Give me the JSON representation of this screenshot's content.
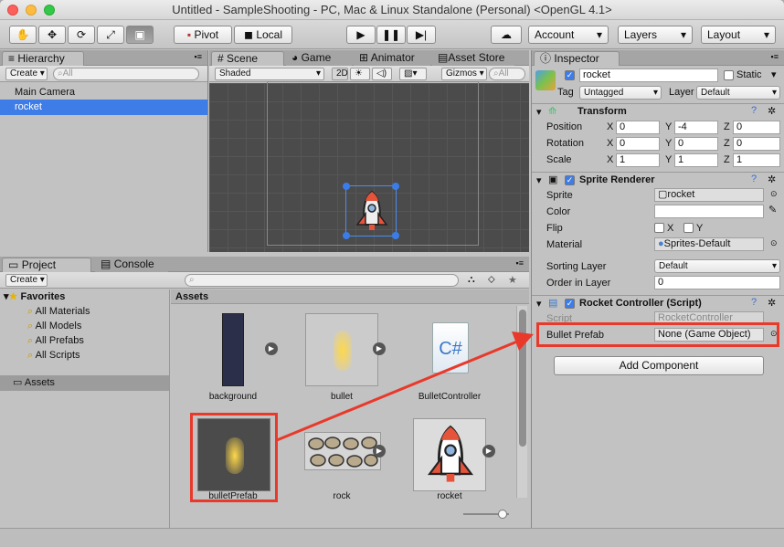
{
  "window": {
    "title": "Untitled - SampleShooting - PC, Mac & Linux Standalone (Personal) <OpenGL 4.1>"
  },
  "toolbar": {
    "pivot": "Pivot",
    "local": "Local",
    "account": "Account",
    "layers": "Layers",
    "layout": "Layout"
  },
  "hierarchy": {
    "tab": "Hierarchy",
    "create": "Create",
    "search_placeholder": "All",
    "items": [
      "Main Camera",
      "rocket"
    ],
    "selected": "rocket"
  },
  "scene": {
    "tabs": [
      "Scene",
      "Game",
      "Animator",
      "Asset Store"
    ],
    "shading": "Shaded",
    "mode2d": "2D",
    "gizmos": "Gizmos",
    "search_placeholder": "All"
  },
  "project": {
    "tabs": [
      "Project",
      "Console"
    ],
    "create": "Create",
    "favorites": "Favorites",
    "fav_items": [
      "All Materials",
      "All Models",
      "All Prefabs",
      "All Scripts"
    ],
    "assets_root": "Assets",
    "breadcrumb": "Assets",
    "assets": [
      "background",
      "bullet",
      "BulletController",
      "bulletPrefab",
      "rock",
      "rocket"
    ]
  },
  "inspector": {
    "tab": "Inspector",
    "name": "rocket",
    "static": "Static",
    "tag_label": "Tag",
    "tag": "Untagged",
    "layer_label": "Layer",
    "layer": "Default",
    "transform": {
      "title": "Transform",
      "rows": [
        {
          "label": "Position",
          "x": "0",
          "y": "-4",
          "z": "0"
        },
        {
          "label": "Rotation",
          "x": "0",
          "y": "0",
          "z": "0"
        },
        {
          "label": "Scale",
          "x": "1",
          "y": "1",
          "z": "1"
        }
      ],
      "axes": [
        "X",
        "Y",
        "Z"
      ]
    },
    "sprite_renderer": {
      "title": "Sprite Renderer",
      "sprite_label": "Sprite",
      "sprite": "rocket",
      "color_label": "Color",
      "flip_label": "Flip",
      "flip_x": "X",
      "flip_y": "Y",
      "material_label": "Material",
      "material": "Sprites-Default",
      "sorting_label": "Sorting Layer",
      "sorting": "Default",
      "order_label": "Order in Layer",
      "order": "0"
    },
    "script": {
      "title": "Rocket Controller (Script)",
      "script_label": "Script",
      "script": "RocketController",
      "bullet_label": "Bullet Prefab",
      "bullet": "None (Game Object)"
    },
    "add_component": "Add Component"
  },
  "colors": {
    "highlight": "#e8392b",
    "selection": "#3e7ce7"
  }
}
